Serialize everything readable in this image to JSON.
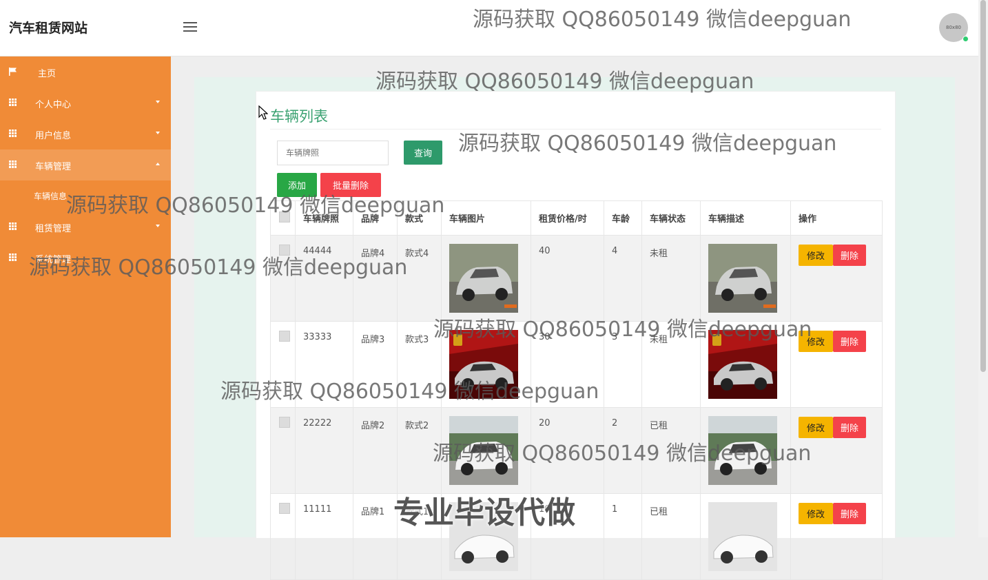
{
  "site": {
    "title": "汽车租赁网站",
    "avatar_text": "80x80"
  },
  "sidebar": {
    "items": [
      {
        "label": "主页",
        "icon": "flag-icon"
      },
      {
        "label": "个人中心",
        "icon": "grid-icon"
      },
      {
        "label": "用户信息",
        "icon": "grid-icon"
      },
      {
        "label": "车辆管理",
        "icon": "grid-icon"
      },
      {
        "label": "租赁管理",
        "icon": "grid-icon"
      },
      {
        "label": "系统管理",
        "icon": "grid-icon"
      }
    ],
    "sub_item": "车辆信息"
  },
  "panel": {
    "title": "车辆列表",
    "search_placeholder": "车辆牌照",
    "query_label": "查询",
    "add_label": "添加",
    "batch_delete_label": "批量删除"
  },
  "table": {
    "headers": [
      "车辆牌照",
      "品牌",
      "款式",
      "车辆图片",
      "租赁价格/时",
      "车龄",
      "车辆状态",
      "车辆描述",
      "操作"
    ],
    "rows": [
      {
        "plate": "44444",
        "brand": "品牌4",
        "style": "款式4",
        "price": "40",
        "age": "4",
        "status": "未租",
        "image": "grey-suv"
      },
      {
        "plate": "33333",
        "brand": "品牌3",
        "style": "款式3",
        "price": "30",
        "age": "3",
        "status": "未租",
        "image": "silver-sportscar"
      },
      {
        "plate": "22222",
        "brand": "品牌2",
        "style": "款式2",
        "price": "20",
        "age": "2",
        "status": "已租",
        "image": "white-suv"
      },
      {
        "plate": "11111",
        "brand": "品牌1",
        "style": "款式1",
        "price": "10",
        "age": "1",
        "status": "已租",
        "image": "white-roadster"
      }
    ],
    "edit_label": "修改",
    "delete_label": "删除"
  },
  "watermark": {
    "text": "源码获取 QQ86050149 微信deepguan",
    "banner": "专业毕设代做"
  }
}
